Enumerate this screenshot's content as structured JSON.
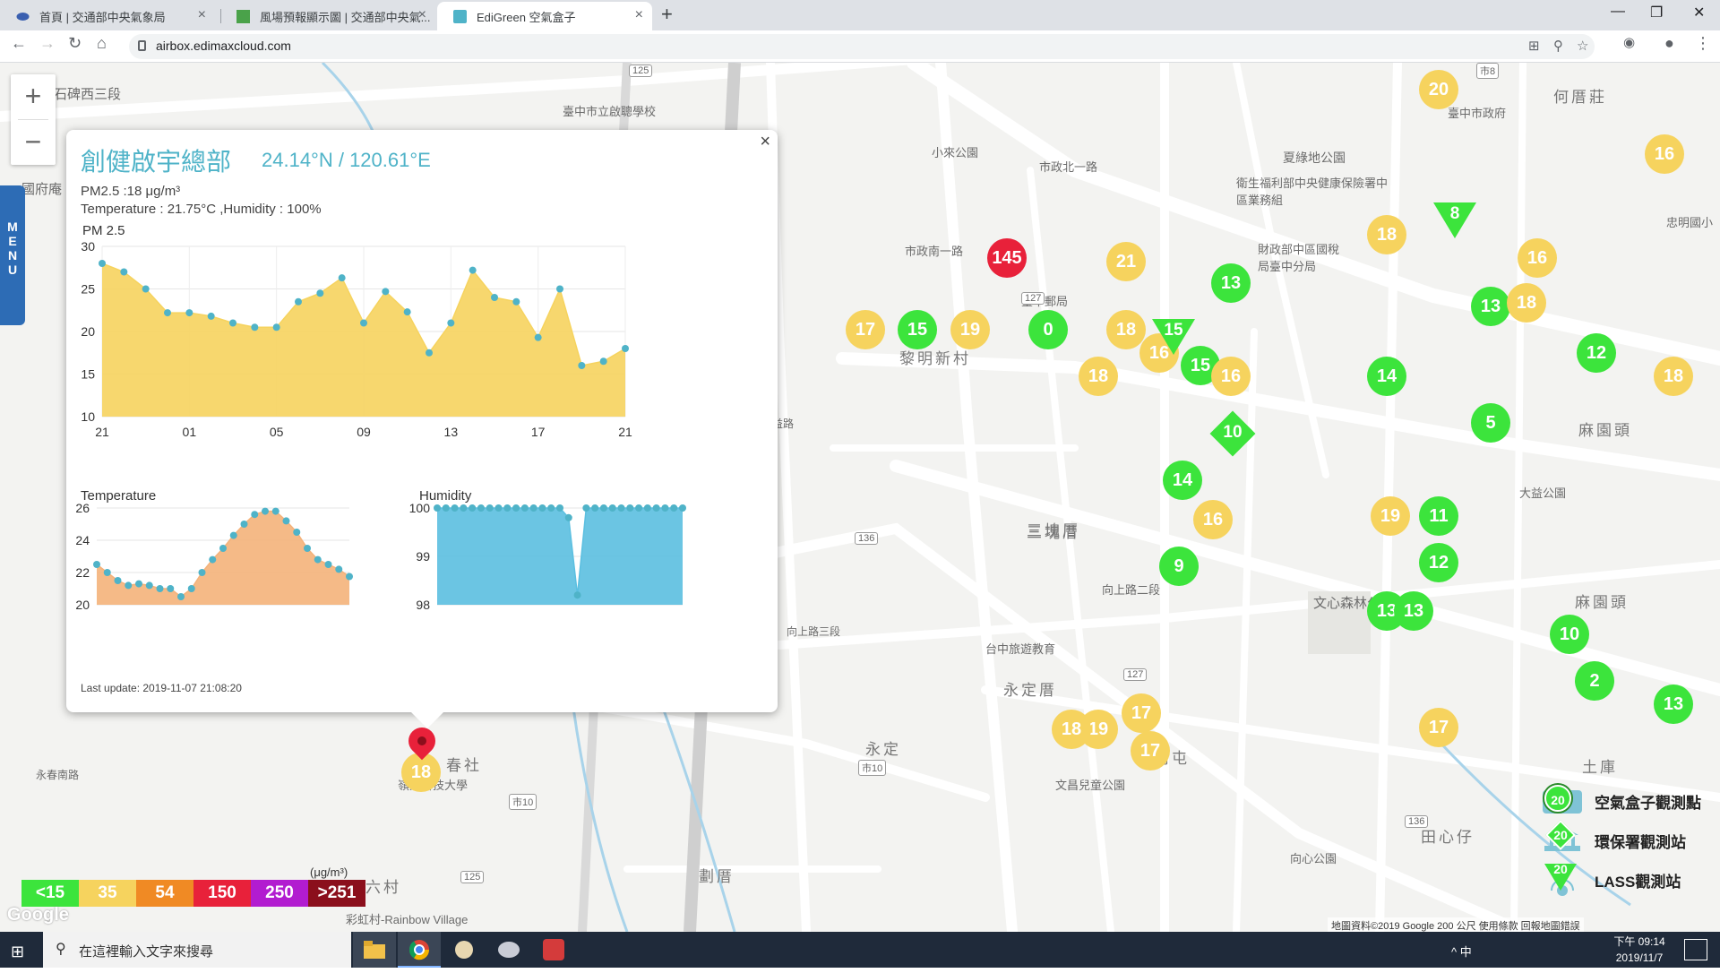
{
  "browser": {
    "tabs": [
      {
        "title": "首頁 | 交通部中央氣象局"
      },
      {
        "title": "風場預報顯示圖 | 交通部中央氣..."
      },
      {
        "title": "EdiGreen 空氣盒子"
      }
    ],
    "url": "airbox.edimaxcloud.com"
  },
  "map": {
    "labels": [
      "石碑西三段",
      "國府庵",
      "臺中市立啟聰學校",
      "小來公園",
      "市政北一路",
      "夏綠地公園",
      "衛生福利部中央健康保險署中區業務組",
      "財政部中區國稅局臺中分局",
      "何厝莊",
      "臺中市政府",
      "市政南一路",
      "臺中郵局",
      "黎明新村",
      "三塊厝",
      "向上路二段",
      "文心森林公園",
      "台中旅遊教育",
      "永定厝",
      "永定",
      "春社",
      "嶺東科技大學",
      "向上路三段",
      "永春南路",
      "劃厝",
      "南屯",
      "文昌兒童公園",
      "三塊厝",
      "田心仔",
      "麻園頭",
      "大益公園",
      "土庫",
      "六村",
      "彩虹村-Rainbow Village",
      "忠明國小",
      "公益路",
      "麻園頭",
      "向心公園",
      "黎明新村"
    ],
    "bubbles": [
      {
        "v": "145",
        "c": "r"
      },
      {
        "v": "21",
        "c": "y"
      },
      {
        "v": "13",
        "c": "g"
      },
      {
        "v": "17",
        "c": "y"
      },
      {
        "v": "15",
        "c": "g"
      },
      {
        "v": "19",
        "c": "y"
      },
      {
        "v": "0",
        "c": "g"
      },
      {
        "v": "18",
        "c": "y"
      },
      {
        "v": "16",
        "c": "y"
      },
      {
        "v": "15",
        "c": "g"
      },
      {
        "v": "16",
        "c": "y"
      },
      {
        "v": "18",
        "c": "y"
      },
      {
        "v": "14",
        "c": "g"
      },
      {
        "v": "16",
        "c": "y"
      },
      {
        "v": "9",
        "c": "g"
      },
      {
        "v": "20",
        "c": "y"
      },
      {
        "v": "16",
        "c": "y"
      },
      {
        "v": "18",
        "c": "y"
      },
      {
        "v": "16",
        "c": "y"
      },
      {
        "v": "13",
        "c": "g"
      },
      {
        "v": "18",
        "c": "y"
      },
      {
        "v": "12",
        "c": "g"
      },
      {
        "v": "18",
        "c": "y"
      },
      {
        "v": "14",
        "c": "g"
      },
      {
        "v": "5",
        "c": "g"
      },
      {
        "v": "19",
        "c": "y"
      },
      {
        "v": "11",
        "c": "g"
      },
      {
        "v": "12",
        "c": "g"
      },
      {
        "v": "13",
        "c": "g"
      },
      {
        "v": "13",
        "c": "g"
      },
      {
        "v": "10",
        "c": "g"
      },
      {
        "v": "2",
        "c": "g"
      },
      {
        "v": "13",
        "c": "g"
      },
      {
        "v": "17",
        "c": "y"
      },
      {
        "v": "19",
        "c": "y"
      },
      {
        "v": "17",
        "c": "y"
      },
      {
        "v": "17",
        "c": "y"
      },
      {
        "v": "18",
        "c": "y"
      },
      {
        "v": "18",
        "c": "y"
      }
    ],
    "triangles": [
      "15",
      "8"
    ],
    "diamonds": [
      "10"
    ],
    "zoom_in": "+",
    "zoom_out": "−",
    "menu": "MENU"
  },
  "popup": {
    "title": "創健啟宇總部",
    "coords": "24.14°N / 120.61°E",
    "pm25_text": "PM2.5 :18 μg/m³",
    "temp_hum_text": "Temperature : 21.75°C ,Humidity : 100%",
    "chart_label": "PM 2.5",
    "temp_label": "Temperature",
    "hum_label": "Humidity",
    "last_update": "Last update: 2019-11-07 21:08:20"
  },
  "chart_data": [
    {
      "type": "area",
      "title": "PM 2.5",
      "ylim": [
        10,
        30
      ],
      "yticks": [
        10,
        15,
        20,
        25,
        30
      ],
      "xticks": [
        "21",
        "01",
        "05",
        "09",
        "13",
        "17",
        "21"
      ],
      "values": [
        28,
        27,
        25,
        22.2,
        22.2,
        21.8,
        21,
        20.5,
        20.5,
        23.5,
        24.5,
        26.3,
        21,
        24.7,
        22.3,
        17.5,
        21,
        27.2,
        24,
        23.5,
        19.3,
        25,
        16,
        16.5,
        18
      ],
      "color": "#f6d35e"
    },
    {
      "type": "area",
      "title": "Temperature",
      "ylim": [
        20,
        26
      ],
      "yticks": [
        20,
        22,
        24,
        26
      ],
      "values": [
        22.5,
        22,
        21.5,
        21.2,
        21.3,
        21.2,
        21,
        21,
        20.5,
        21,
        22,
        22.8,
        23.5,
        24.3,
        25,
        25.6,
        25.8,
        25.8,
        25.2,
        24.5,
        23.5,
        22.8,
        22.5,
        22.2,
        21.75
      ],
      "color": "#f4b27a"
    },
    {
      "type": "area",
      "title": "Humidity",
      "ylim": [
        98,
        100
      ],
      "yticks": [
        98,
        99,
        100
      ],
      "values": [
        100,
        100,
        100,
        100,
        100,
        100,
        100,
        100,
        100,
        100,
        100,
        100,
        100,
        100,
        100,
        99.8,
        98.2,
        100,
        100,
        100,
        100,
        100,
        100,
        100,
        100,
        100,
        100,
        100,
        100
      ],
      "color": "#5bbfe0"
    }
  ],
  "legend": {
    "scale": [
      {
        "label": "<15",
        "color": "#3ce43c"
      },
      {
        "label": "35",
        "color": "#f6d35e"
      },
      {
        "label": "54",
        "color": "#f08a24"
      },
      {
        "label": "150",
        "color": "#e8213a"
      },
      {
        "label": "250",
        "color": "#b21cd0"
      },
      {
        "label": ">251",
        "color": "#8b0f1c"
      }
    ],
    "unit": "(μg/m³)",
    "google": "Google",
    "station_types": [
      "空氣盒子觀測點",
      "環保署觀測站",
      "LASS觀測站"
    ],
    "attribution": "地圖資料©2019 Google   200 公尺   使用條款   回報地圖錯誤"
  },
  "taskbar": {
    "search_placeholder": "在這裡輸入文字來搜尋",
    "time": "下午 09:14",
    "date": "2019/11/7",
    "tray": "^ 中"
  }
}
